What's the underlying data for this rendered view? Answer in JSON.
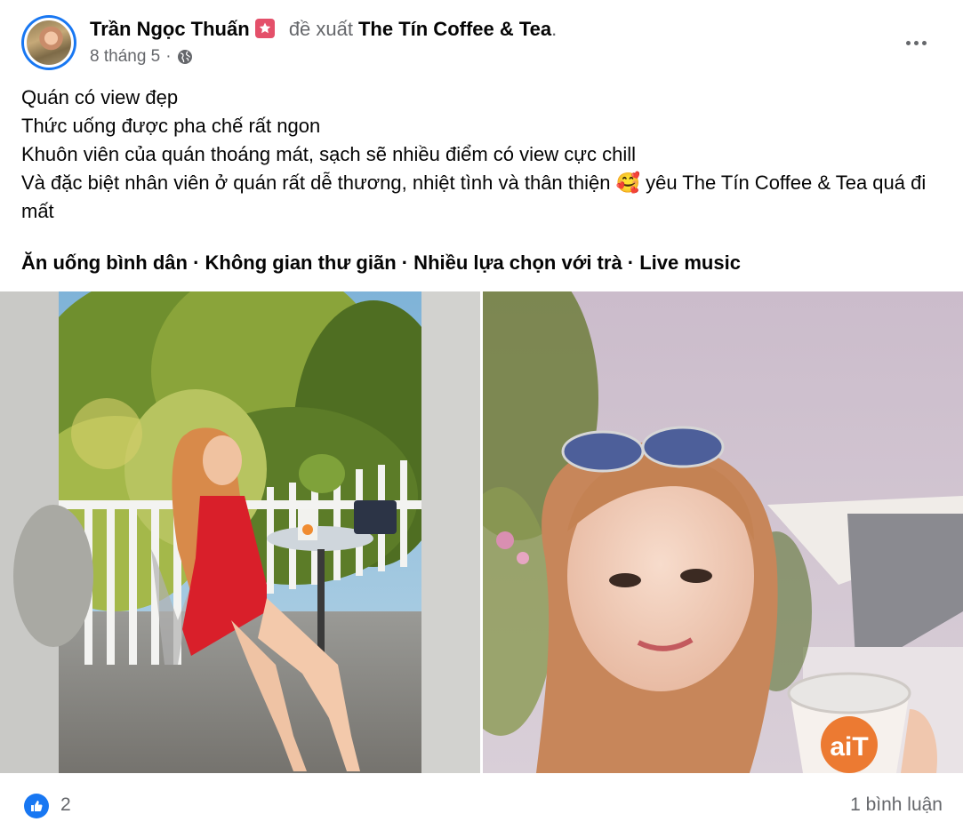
{
  "post": {
    "author": "Trần Ngọc Thuấn",
    "recommends_label": "đề xuất",
    "page_name": "The Tín Coffee & Tea",
    "period": ".",
    "date": "8 tháng 5",
    "separator": "·",
    "lines": [
      "Quán có view đẹp",
      "Thức uống được pha chế rất ngon",
      "Khuôn viên của quán thoáng mát, sạch sẽ nhiều điểm có view cực chill",
      "Và đặc biệt nhân viên ở quán rất dễ thương, nhiệt tình và thân thiện 🥰 yêu The Tín Coffee & Tea quá đi mất"
    ],
    "tags": "Ăn uống bình dân · Không gian thư giãn · Nhiều lựa chọn với trà · Live music",
    "cup_logo_text": "aiT"
  },
  "footer": {
    "reaction_count": "2",
    "comments": "1 bình luận"
  },
  "icons": {
    "badge": "star-badge-icon",
    "privacy": "globe-icon",
    "menu": "more-horizontal-icon",
    "reaction": "like-icon"
  },
  "colors": {
    "accent": "#1877f2",
    "secondary_text": "#65676b",
    "badge": "#e4506a"
  }
}
